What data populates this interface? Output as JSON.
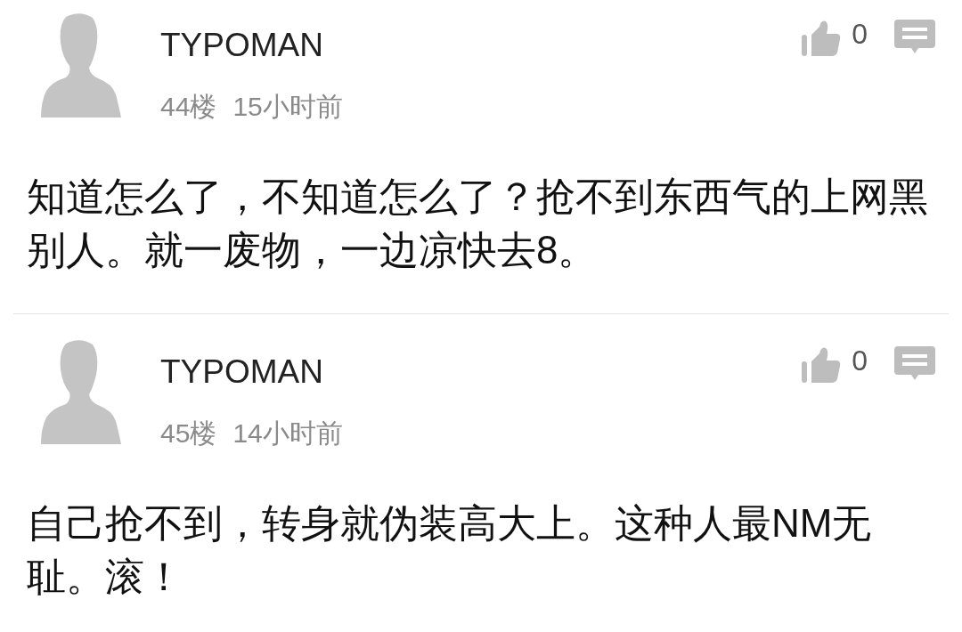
{
  "comments": [
    {
      "username": "TYPOMAN",
      "floor": "44楼",
      "time": "15小时前",
      "likes": "0",
      "text": "知道怎么了，不知道怎么了？抢不到东西气的上网黑别人。就一废物，一边凉快去8。"
    },
    {
      "username": "TYPOMAN",
      "floor": "45楼",
      "time": "14小时前",
      "likes": "0",
      "text": "自己抢不到，转身就伪装高大上。这种人最NM无耻。滚！"
    }
  ]
}
